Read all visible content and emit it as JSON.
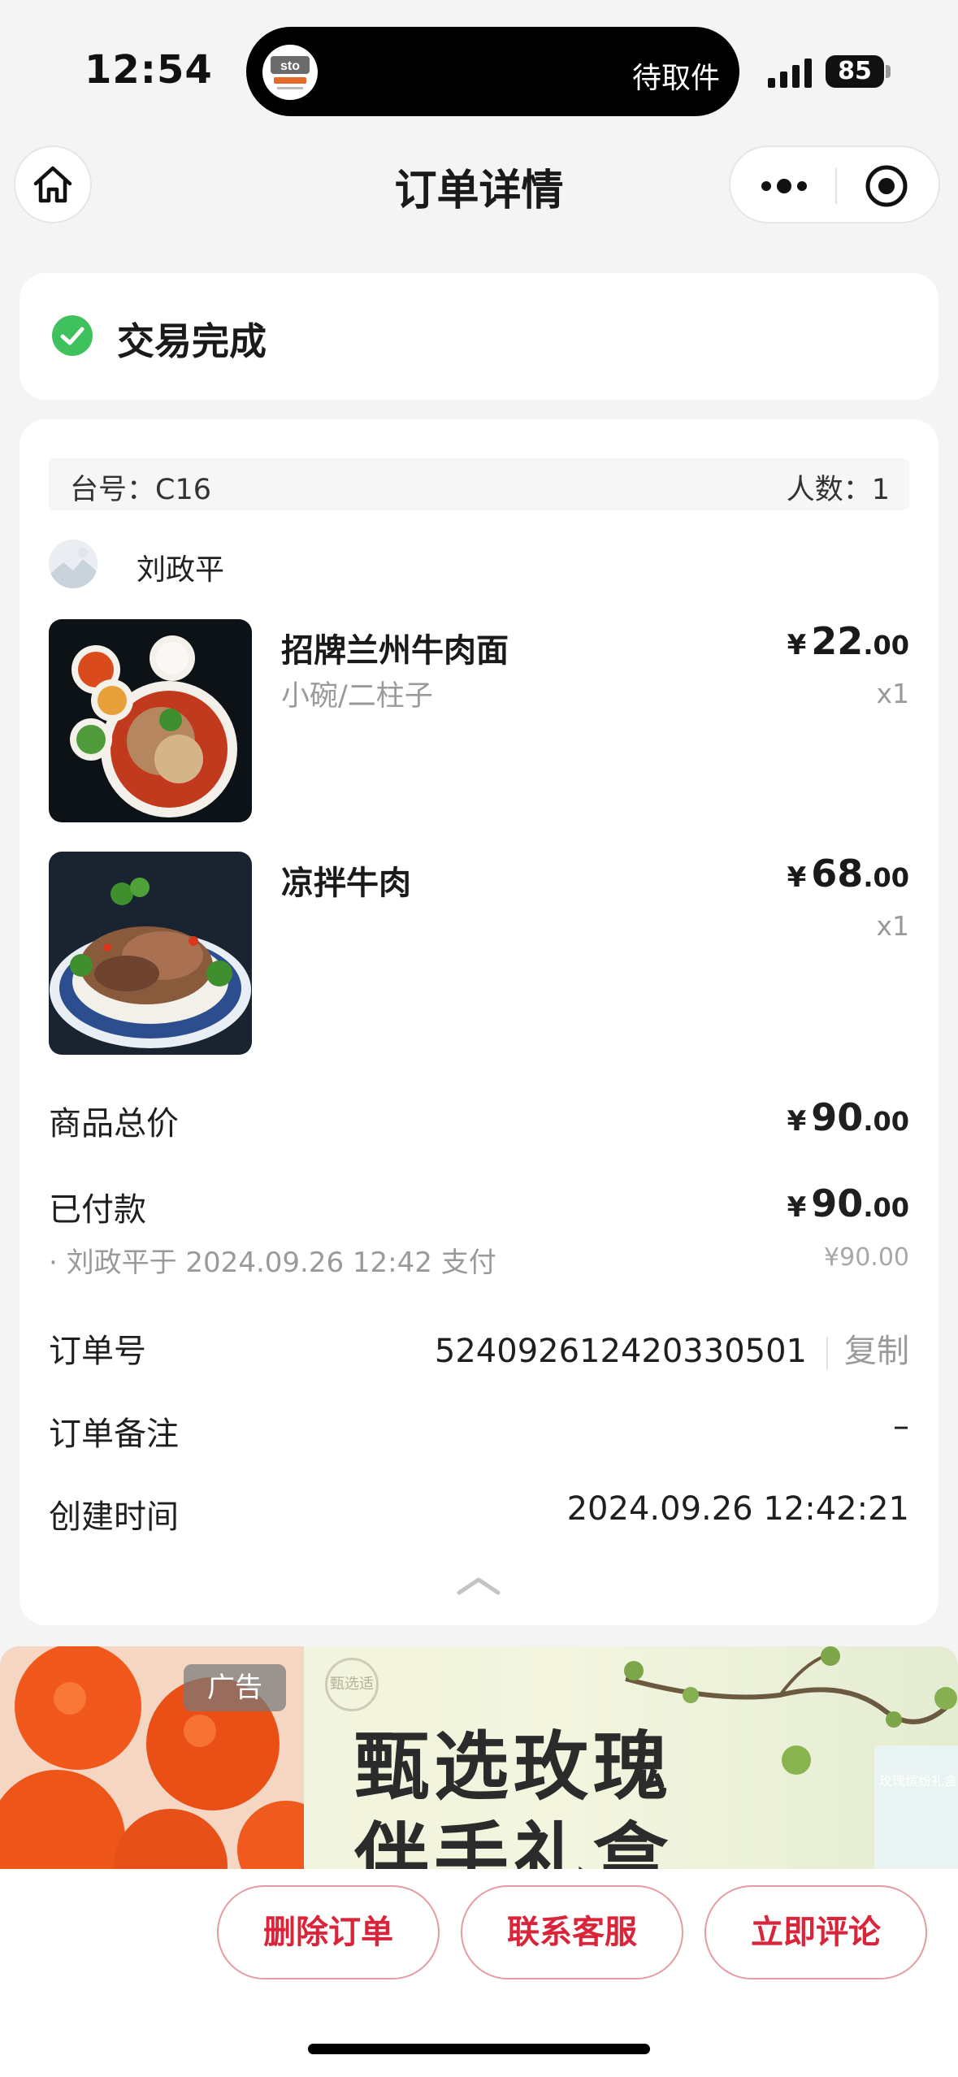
{
  "status_bar": {
    "time": "12:54",
    "island_text": "待取件",
    "island_logo_icon": "sto-express-logo",
    "battery": "85"
  },
  "nav": {
    "title": "订单详情",
    "home_icon": "home-icon",
    "more_icon": "more-dots-icon",
    "target_icon": "target-icon"
  },
  "order_status": {
    "text": "交易完成",
    "icon": "check-circle-icon",
    "color": "#3fc25d"
  },
  "order": {
    "table_label": "台号：C16",
    "people_label": "人数：1",
    "user_name": "刘政平",
    "items": [
      {
        "name": "招牌兰州牛肉面",
        "spec": "小碗/二柱子",
        "currency": "¥",
        "price_int": "22",
        "price_dec": ".00",
        "qty": "x1"
      },
      {
        "name": "凉拌牛肉",
        "spec": "",
        "currency": "¥",
        "price_int": "68",
        "price_dec": ".00",
        "qty": "x1"
      }
    ],
    "total": {
      "label": "商品总价",
      "currency": "¥",
      "int": "90",
      "dec": ".00"
    },
    "paid": {
      "label": "已付款",
      "currency": "¥",
      "int": "90",
      "dec": ".00"
    },
    "payment_note": "· 刘政平于 2024.09.26 12:42 支付",
    "payment_note_amount": "¥90.00",
    "order_no": {
      "label": "订单号",
      "value": "524092612420330501",
      "copy": "复制"
    },
    "remark": {
      "label": "订单备注",
      "value": "–"
    },
    "created": {
      "label": "创建时间",
      "value": "2024.09.26 12:42:21"
    }
  },
  "ad": {
    "tag": "广告",
    "brand": "甄选适",
    "title_line1": "甄选玫瑰",
    "title_line2": "伴手礼盒",
    "box_text": "玫瑰缤纷礼盒"
  },
  "actions": {
    "delete": "删除订单",
    "contact": "联系客服",
    "review": "立即评论",
    "accent_color": "#d9243a"
  }
}
